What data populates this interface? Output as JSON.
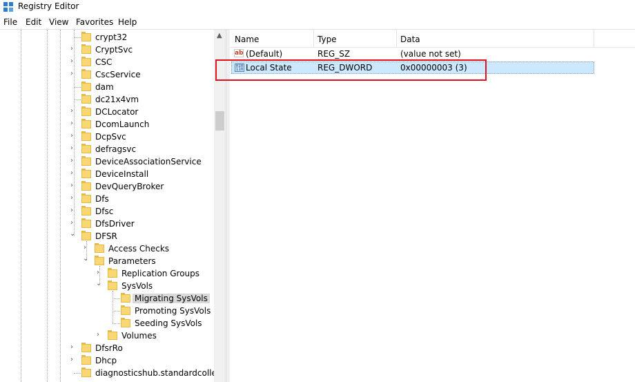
{
  "window": {
    "title": "Registry Editor"
  },
  "menu": [
    "File",
    "Edit",
    "View",
    "Favorites",
    "Help"
  ],
  "tree": [
    {
      "label": "crypt32",
      "chevron": ""
    },
    {
      "label": "CryptSvc",
      "chevron": "›"
    },
    {
      "label": "CSC",
      "chevron": "›"
    },
    {
      "label": "CscService",
      "chevron": "›"
    },
    {
      "label": "dam",
      "chevron": ""
    },
    {
      "label": "dc21x4vm",
      "chevron": ""
    },
    {
      "label": "DCLocator",
      "chevron": "›"
    },
    {
      "label": "DcomLaunch",
      "chevron": "›"
    },
    {
      "label": "DcpSvc",
      "chevron": "›"
    },
    {
      "label": "defragsvc",
      "chevron": "›"
    },
    {
      "label": "DeviceAssociationService",
      "chevron": "›"
    },
    {
      "label": "DeviceInstall",
      "chevron": "›"
    },
    {
      "label": "DevQueryBroker",
      "chevron": "›"
    },
    {
      "label": "Dfs",
      "chevron": "›"
    },
    {
      "label": "Dfsc",
      "chevron": "›"
    },
    {
      "label": "DfsDriver",
      "chevron": "›"
    },
    {
      "label": "DFSR",
      "chevron": "⌄"
    },
    {
      "label": "Access Checks",
      "chevron": "›"
    },
    {
      "label": "Parameters",
      "chevron": "⌄"
    },
    {
      "label": "Replication Groups",
      "chevron": "›"
    },
    {
      "label": "SysVols",
      "chevron": "⌄"
    },
    {
      "label": "Migrating SysVols",
      "chevron": ""
    },
    {
      "label": "Promoting SysVols",
      "chevron": ""
    },
    {
      "label": "Seeding SysVols",
      "chevron": ""
    },
    {
      "label": "Volumes",
      "chevron": "›"
    },
    {
      "label": "DfsrRo",
      "chevron": "›"
    },
    {
      "label": "Dhcp",
      "chevron": "›"
    },
    {
      "label": "diagnosticshub.standardcollecto",
      "chevron": ""
    }
  ],
  "list": {
    "columns": [
      "Name",
      "Type",
      "Data"
    ],
    "rows": [
      {
        "name": "(Default)",
        "type": "REG_SZ",
        "data": "(value not set)",
        "icon": "string-value-icon"
      },
      {
        "name": "Local State",
        "type": "REG_DWORD",
        "data": "0x00000003 (3)",
        "icon": "dword-value-icon"
      }
    ]
  },
  "colors": {
    "selection": "#cce8ff",
    "highlight_box": "#e3101b",
    "folder": "#f8d775"
  }
}
